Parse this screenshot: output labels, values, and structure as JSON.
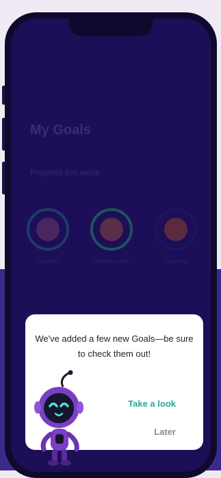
{
  "screen": {
    "title": "My Goals",
    "subtitle": "Progress this week",
    "goals": [
      {
        "label": "Completed"
      },
      {
        "label": "Added this week"
      },
      {
        "label": "Upcoming"
      }
    ]
  },
  "dialog": {
    "message": "We've added a few new Goals—be sure to check them out!",
    "primary_label": "Take a look",
    "secondary_label": "Later"
  },
  "colors": {
    "accent": "#2aa899",
    "mascot": "#7a3fc4",
    "background_band": "#3b2a8c"
  },
  "icons": {
    "mascot": "robot-mascot-icon"
  }
}
